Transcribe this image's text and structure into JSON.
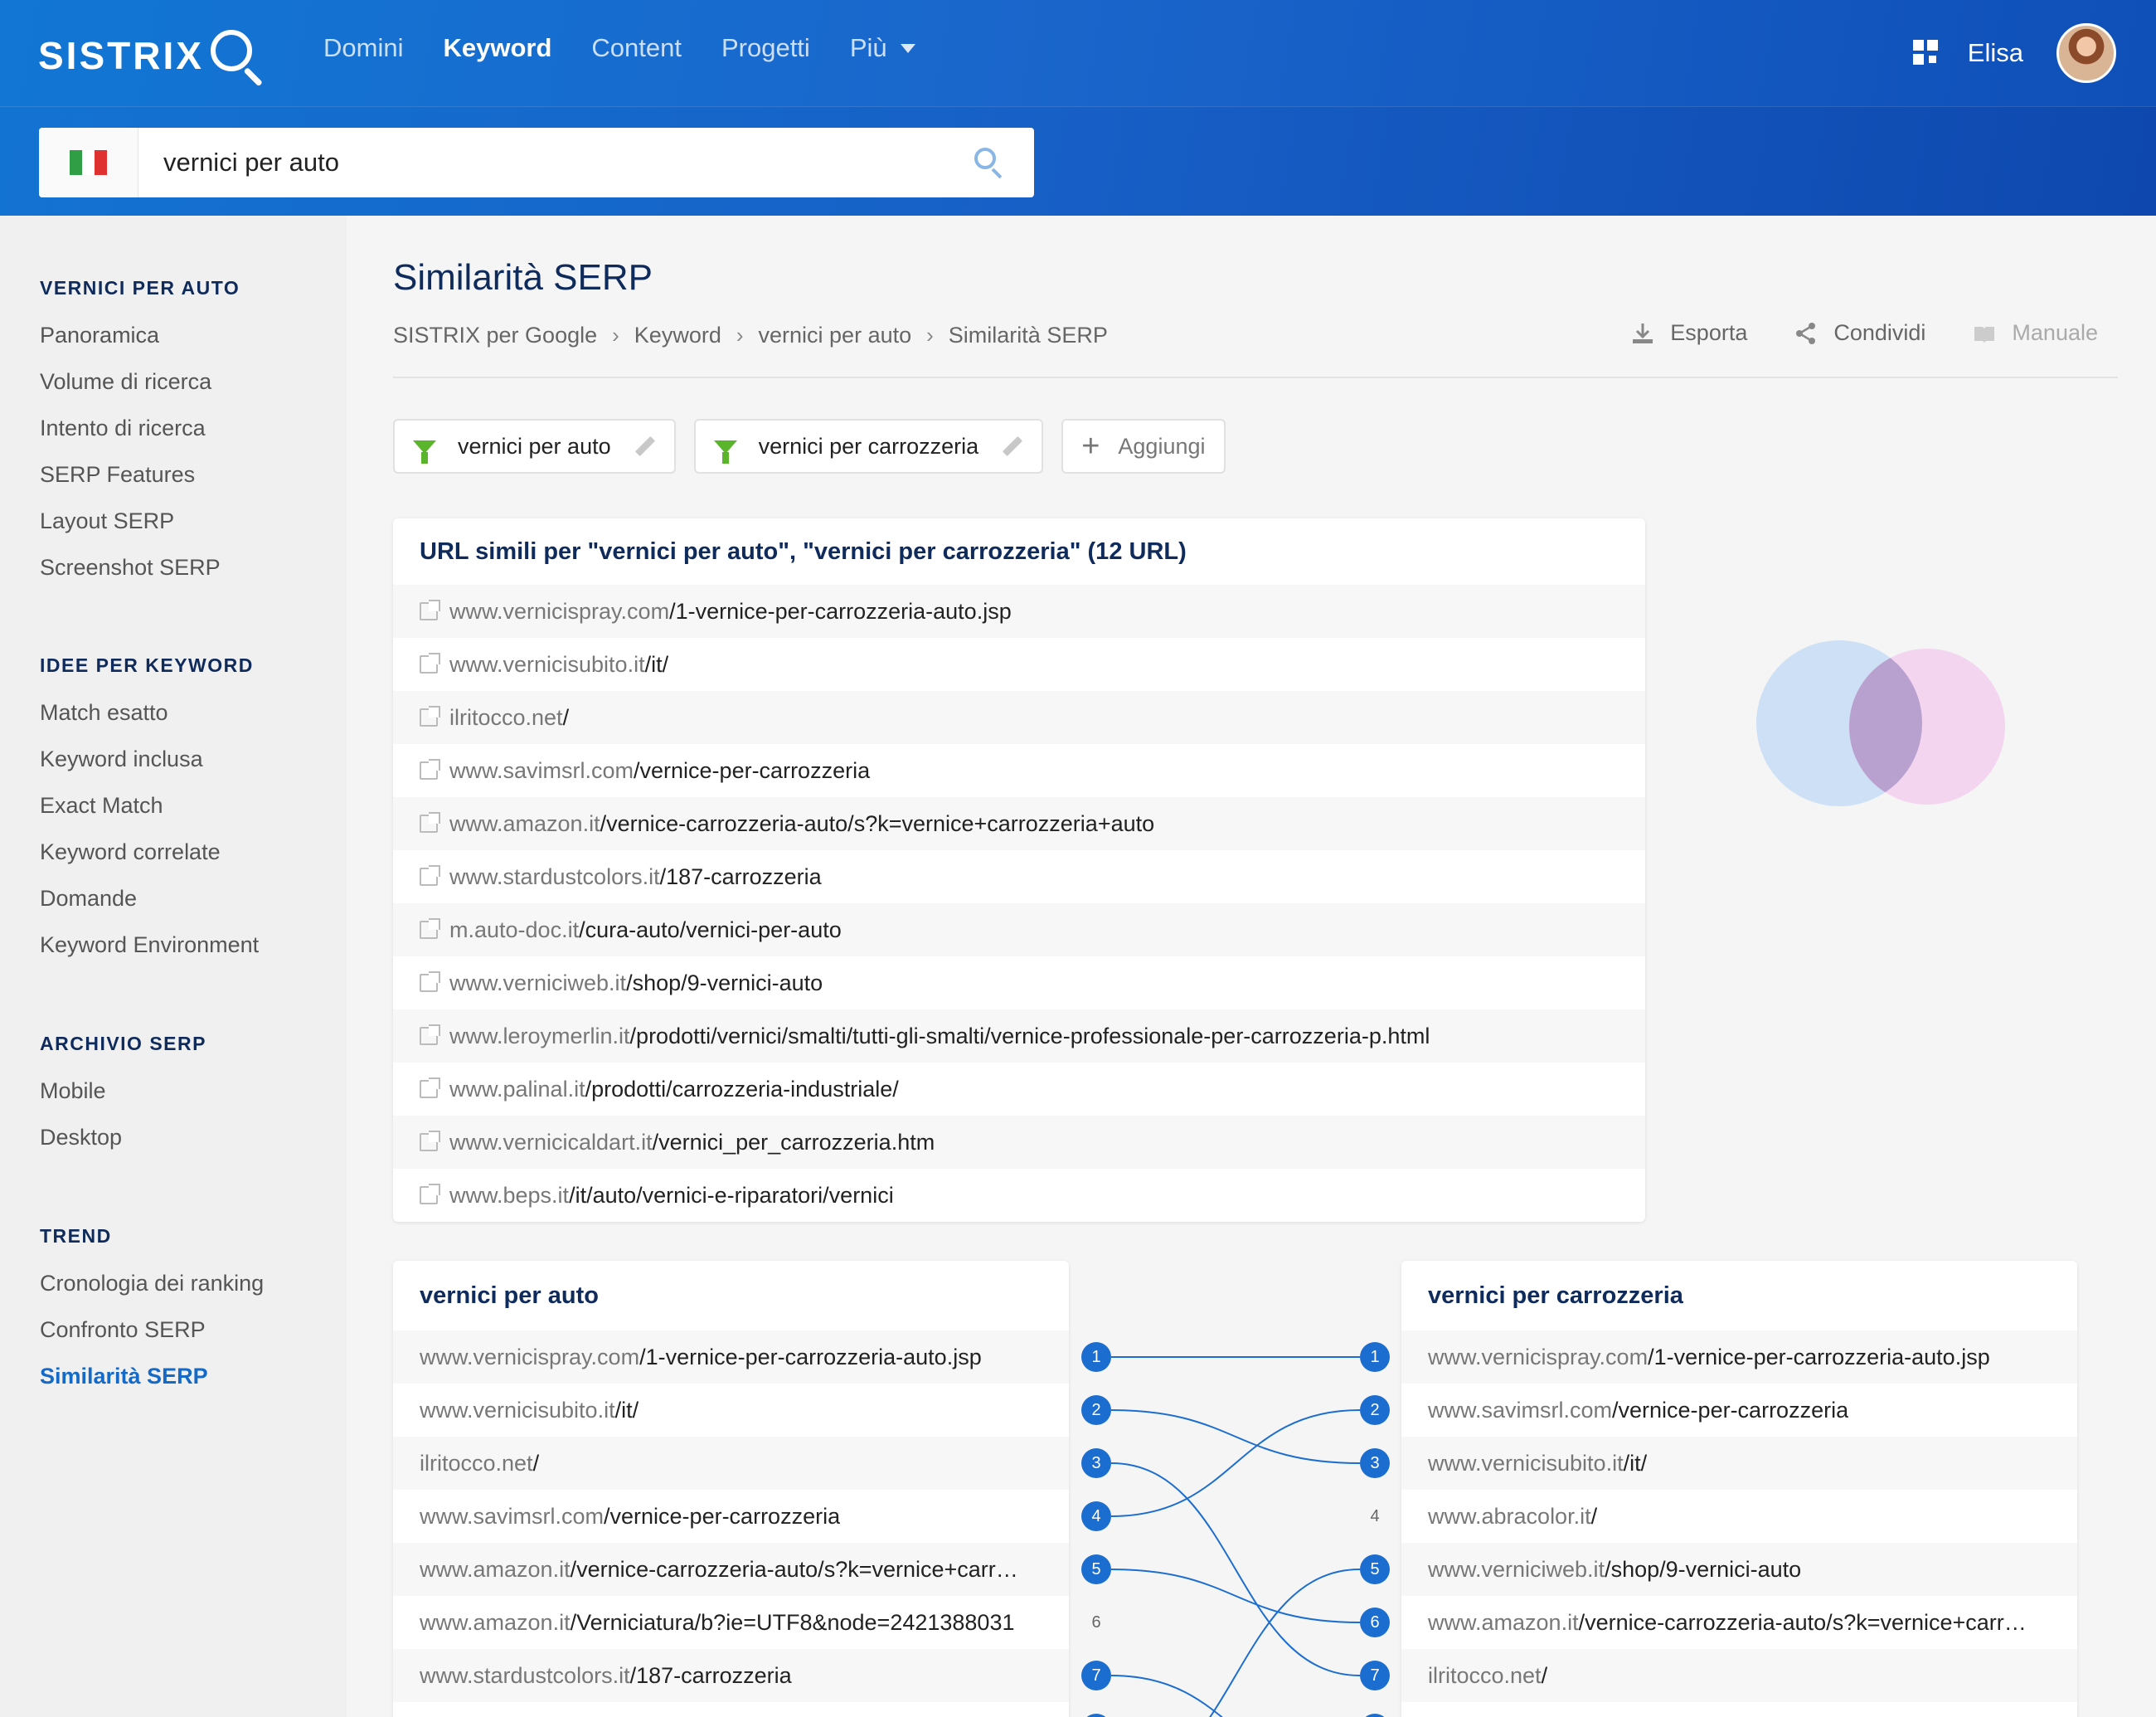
{
  "header": {
    "logo": "SISTRIX",
    "nav": [
      {
        "label": "Domini",
        "active": false
      },
      {
        "label": "Keyword",
        "active": true
      },
      {
        "label": "Content",
        "active": false
      },
      {
        "label": "Progetti",
        "active": false
      },
      {
        "label": "Più",
        "active": false,
        "dropdown": true
      }
    ],
    "user_name": "Elisa",
    "apps_icon": "grid-icon"
  },
  "search": {
    "value": "vernici per auto",
    "country_flag": "italy-flag",
    "button_icon": "search-icon"
  },
  "sidebar": {
    "sections": [
      {
        "heading": "VERNICI PER AUTO",
        "items": [
          "Panoramica",
          "Volume di ricerca",
          "Intento di ricerca",
          "SERP Features",
          "Layout SERP",
          "Screenshot SERP"
        ]
      },
      {
        "heading": "IDEE PER KEYWORD",
        "items": [
          "Match esatto",
          "Keyword inclusa",
          "Exact Match",
          "Keyword correlate",
          "Domande",
          "Keyword Environment"
        ]
      },
      {
        "heading": "ARCHIVIO SERP",
        "items": [
          "Mobile",
          "Desktop"
        ]
      },
      {
        "heading": "TREND",
        "items": [
          "Cronologia dei ranking",
          "Confronto SERP",
          "Similarità SERP"
        ]
      }
    ],
    "active_item": "Similarità SERP"
  },
  "main": {
    "title": "Similarità SERP",
    "breadcrumb": [
      "SISTRIX per Google",
      "Keyword",
      "vernici per auto",
      "Similarità SERP"
    ],
    "actions": [
      {
        "label": "Esporta",
        "icon": "download-icon",
        "disabled": false
      },
      {
        "label": "Condividi",
        "icon": "share-icon",
        "disabled": false
      },
      {
        "label": "Manuale",
        "icon": "book-icon",
        "disabled": true
      }
    ],
    "filters": [
      {
        "label": "vernici per auto"
      },
      {
        "label": "vernici per carrozzeria"
      }
    ],
    "add_filter_label": "Aggiungi"
  },
  "similar_urls": {
    "title": "URL simili per \"vernici per auto\", \"vernici per carrozzeria\" (12 URL)",
    "rows": [
      {
        "domain": "www.vernicispray.com",
        "path": "/1-vernice-per-carrozzeria-auto.jsp"
      },
      {
        "domain": "www.vernicisubito.it",
        "path": "/it/"
      },
      {
        "domain": "ilritocco.net",
        "path": "/"
      },
      {
        "domain": "www.savimsrl.com",
        "path": "/vernice-per-carrozzeria"
      },
      {
        "domain": "www.amazon.it",
        "path": "/vernice-carrozzeria-auto/s?k=vernice+carrozzeria+auto"
      },
      {
        "domain": "www.stardustcolors.it",
        "path": "/187-carrozzeria"
      },
      {
        "domain": "m.auto-doc.it",
        "path": "/cura-auto/vernici-per-auto"
      },
      {
        "domain": "www.verniciweb.it",
        "path": "/shop/9-vernici-auto"
      },
      {
        "domain": "www.leroymerlin.it",
        "path": "/prodotti/vernici/smalti/tutti-gli-smalti/vernice-professionale-per-carrozzeria-p.html"
      },
      {
        "domain": "www.palinal.it",
        "path": "/prodotti/carrozzeria-industriale/"
      },
      {
        "domain": "www.vernicicaldart.it",
        "path": "/vernici_per_carrozzeria.htm"
      },
      {
        "domain": "www.beps.it",
        "path": "/it/auto/vernici-e-riparatori/vernici"
      }
    ]
  },
  "venn": {
    "left_color": "#c7dcf5",
    "right_color": "#f3c9ee",
    "overlap_color": "#b9a1cf"
  },
  "compare": {
    "left": {
      "title": "vernici per auto",
      "rows": [
        {
          "rank": "1",
          "domain": "www.vernicispray.com",
          "path": "/1-vernice-per-carrozzeria-auto.jsp",
          "linked": true
        },
        {
          "rank": "2",
          "domain": "www.vernicisubito.it",
          "path": "/it/",
          "linked": true
        },
        {
          "rank": "3",
          "domain": "ilritocco.net",
          "path": "/",
          "linked": true
        },
        {
          "rank": "4",
          "domain": "www.savimsrl.com",
          "path": "/vernice-per-carrozzeria",
          "linked": true
        },
        {
          "rank": "5",
          "domain": "www.amazon.it",
          "path": "/vernice-carrozzeria-auto/s?k=vernice+carr…",
          "linked": true
        },
        {
          "rank": "6",
          "domain": "www.amazon.it",
          "path": "/Verniciatura/b?ie=UTF8&node=2421388031",
          "linked": false
        },
        {
          "rank": "7",
          "domain": "www.stardustcolors.it",
          "path": "/187-carrozzeria",
          "linked": true
        }
      ]
    },
    "right": {
      "title": "vernici per carrozzeria",
      "rows": [
        {
          "rank": "1",
          "domain": "www.vernicispray.com",
          "path": "/1-vernice-per-carrozzeria-auto.jsp",
          "linked": true
        },
        {
          "rank": "2",
          "domain": "www.savimsrl.com",
          "path": "/vernice-per-carrozzeria",
          "linked": true
        },
        {
          "rank": "3",
          "domain": "www.vernicisubito.it",
          "path": "/it/",
          "linked": true
        },
        {
          "rank": "4",
          "domain": "www.abracolor.it",
          "path": "/",
          "linked": false
        },
        {
          "rank": "5",
          "domain": "www.verniciweb.it",
          "path": "/shop/9-vernici-auto",
          "linked": true
        },
        {
          "rank": "6",
          "domain": "www.amazon.it",
          "path": "/vernice-carrozzeria-auto/s?k=vernice+carr…",
          "linked": true
        },
        {
          "rank": "7",
          "domain": "ilritocco.net",
          "path": "/",
          "linked": true
        }
      ]
    },
    "connections": [
      [
        1,
        1
      ],
      [
        2,
        3
      ],
      [
        3,
        7
      ],
      [
        4,
        2
      ],
      [
        5,
        6
      ]
    ],
    "accent_color": "#1c6dd0"
  }
}
